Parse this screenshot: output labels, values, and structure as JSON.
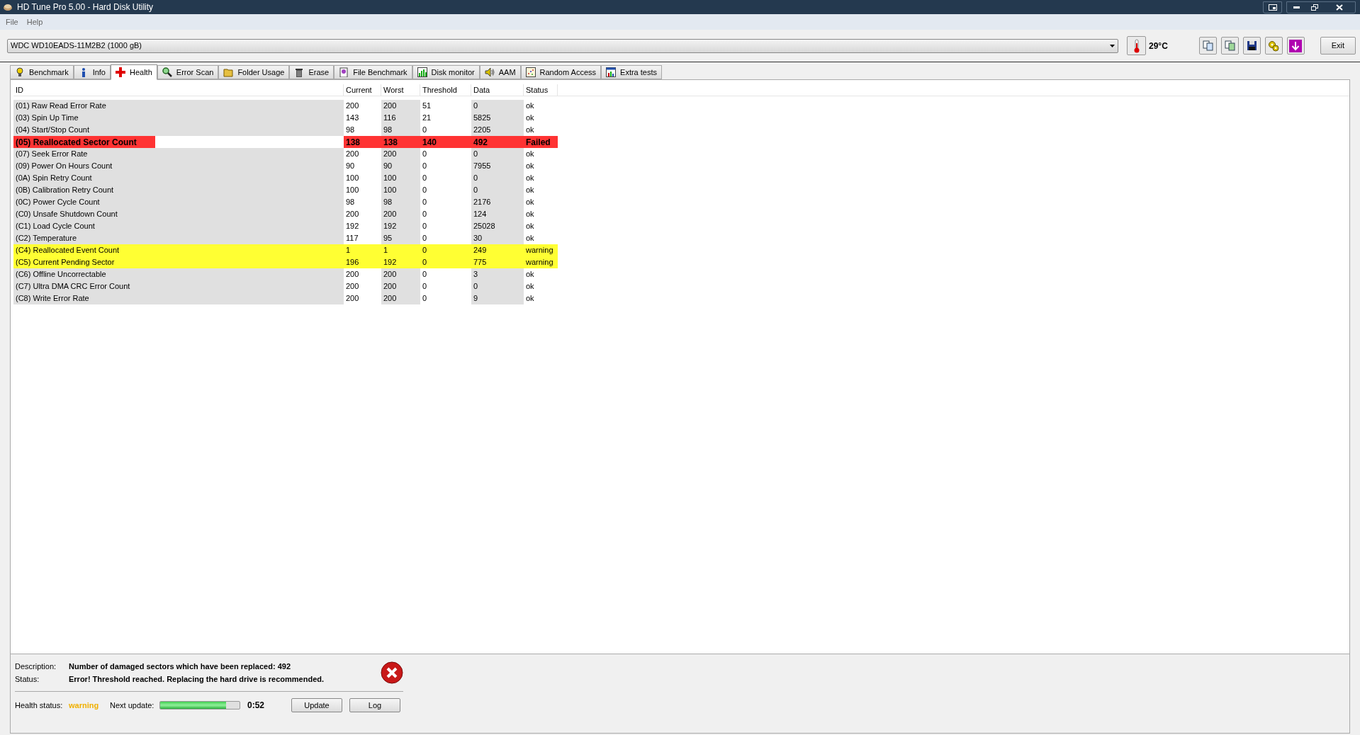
{
  "window": {
    "title": "HD Tune Pro 5.00 - Hard Disk Utility"
  },
  "menu": [
    "File",
    "Help"
  ],
  "toolbar": {
    "drive": "WDC WD10EADS-11M2B2 (1000 gB)",
    "temperature": "29°C",
    "exit": "Exit"
  },
  "tabs": [
    {
      "label": "Benchmark",
      "selected": false
    },
    {
      "label": "Info",
      "selected": false
    },
    {
      "label": "Health",
      "selected": true
    },
    {
      "label": "Error Scan",
      "selected": false
    },
    {
      "label": "Folder Usage",
      "selected": false
    },
    {
      "label": "Erase",
      "selected": false
    },
    {
      "label": "File Benchmark",
      "selected": false
    },
    {
      "label": "Disk monitor",
      "selected": false
    },
    {
      "label": "AAM",
      "selected": false
    },
    {
      "label": "Random Access",
      "selected": false
    },
    {
      "label": "Extra tests",
      "selected": false
    }
  ],
  "table": {
    "columns": [
      "ID",
      "Current",
      "Worst",
      "Threshold",
      "Data",
      "Status"
    ],
    "rows": [
      {
        "kind": "ok",
        "cells": [
          "(01) Raw Read Error Rate",
          "200",
          "200",
          "51",
          "0",
          "ok"
        ]
      },
      {
        "kind": "ok",
        "cells": [
          "(03) Spin Up Time",
          "143",
          "116",
          "21",
          "5825",
          "ok"
        ]
      },
      {
        "kind": "ok",
        "cells": [
          "(04) Start/Stop Count",
          "98",
          "98",
          "0",
          "2205",
          "ok"
        ]
      },
      {
        "kind": "failed",
        "cells": [
          "(05) Reallocated Sector Count",
          "138",
          "138",
          "140",
          "492",
          "Failed"
        ]
      },
      {
        "kind": "ok",
        "cells": [
          "(07) Seek Error Rate",
          "200",
          "200",
          "0",
          "0",
          "ok"
        ]
      },
      {
        "kind": "ok",
        "cells": [
          "(09) Power On Hours Count",
          "90",
          "90",
          "0",
          "7955",
          "ok"
        ]
      },
      {
        "kind": "ok",
        "cells": [
          "(0A) Spin Retry Count",
          "100",
          "100",
          "0",
          "0",
          "ok"
        ]
      },
      {
        "kind": "ok",
        "cells": [
          "(0B) Calibration Retry Count",
          "100",
          "100",
          "0",
          "0",
          "ok"
        ]
      },
      {
        "kind": "ok",
        "cells": [
          "(0C) Power Cycle Count",
          "98",
          "98",
          "0",
          "2176",
          "ok"
        ]
      },
      {
        "kind": "ok",
        "cells": [
          "(C0) Unsafe Shutdown Count",
          "200",
          "200",
          "0",
          "124",
          "ok"
        ]
      },
      {
        "kind": "ok",
        "cells": [
          "(C1) Load Cycle Count",
          "192",
          "192",
          "0",
          "25028",
          "ok"
        ]
      },
      {
        "kind": "ok",
        "cells": [
          "(C2) Temperature",
          "117",
          "95",
          "0",
          "30",
          "ok"
        ]
      },
      {
        "kind": "warning",
        "cells": [
          "(C4) Reallocated Event Count",
          "1",
          "1",
          "0",
          "249",
          "warning"
        ]
      },
      {
        "kind": "warning",
        "cells": [
          "(C5) Current Pending Sector",
          "196",
          "192",
          "0",
          "775",
          "warning"
        ]
      },
      {
        "kind": "ok",
        "cells": [
          "(C6) Offline Uncorrectable",
          "200",
          "200",
          "0",
          "3",
          "ok"
        ]
      },
      {
        "kind": "ok",
        "cells": [
          "(C7) Ultra DMA CRC Error Count",
          "200",
          "200",
          "0",
          "0",
          "ok"
        ]
      },
      {
        "kind": "ok",
        "cells": [
          "(C8) Write Error Rate",
          "200",
          "200",
          "0",
          "9",
          "ok"
        ]
      }
    ]
  },
  "details": {
    "description_label": "Description:",
    "description": "Number of damaged sectors which have been replaced: 492",
    "status_label": "Status:",
    "status": "Error! Threshold reached. Replacing the hard drive is recommended.",
    "kind": "error"
  },
  "footer": {
    "health_label": "Health status:",
    "health": "warning",
    "next_label": "Next update:",
    "level": 0.83,
    "countdown": "0:52",
    "buttons": [
      "Update",
      "Log"
    ]
  }
}
